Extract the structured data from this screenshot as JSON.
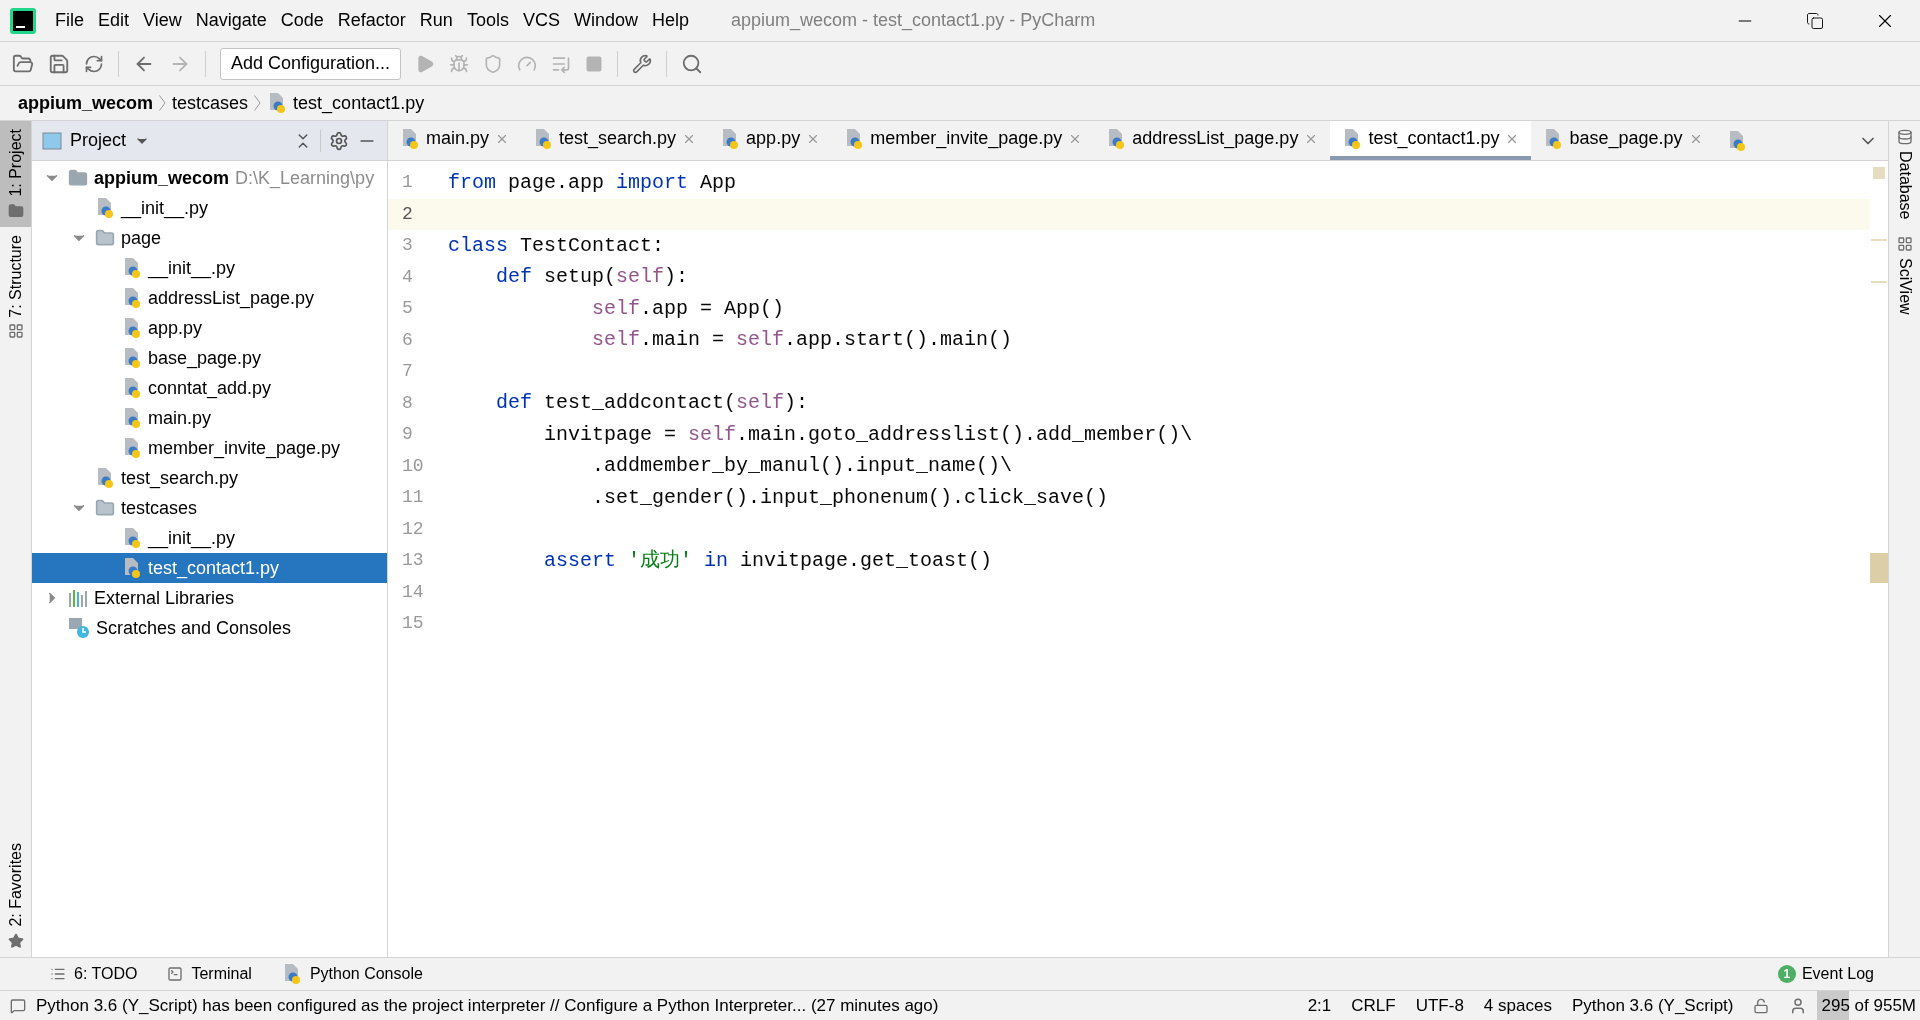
{
  "window": {
    "title": "appium_wecom - test_contact1.py - PyCharm"
  },
  "menu": [
    "File",
    "Edit",
    "View",
    "Navigate",
    "Code",
    "Refactor",
    "Run",
    "Tools",
    "VCS",
    "Window",
    "Help"
  ],
  "toolbar": {
    "run_configuration": "Add Configuration..."
  },
  "breadcrumb": [
    {
      "label": "appium_wecom",
      "kind": "project"
    },
    {
      "label": "testcases",
      "kind": "folder"
    },
    {
      "label": "test_contact1.py",
      "kind": "file"
    }
  ],
  "left_stripe": [
    {
      "label": "1: Project",
      "selected": true,
      "kind": "project"
    },
    {
      "label": "7: Structure",
      "selected": false,
      "kind": "structure"
    },
    {
      "label": "2: Favorites",
      "selected": false,
      "kind": "favorites"
    }
  ],
  "project_panel": {
    "title": "Project",
    "tree": [
      {
        "label": "appium_wecom",
        "hint": "D:\\K_Learning\\py",
        "kind": "root",
        "expanded": true,
        "selected": false,
        "children": [
          {
            "label": "__init__.py",
            "kind": "file",
            "selected": false
          },
          {
            "label": "page",
            "kind": "folder",
            "expanded": true,
            "selected": false,
            "children": [
              {
                "label": "__init__.py",
                "kind": "file",
                "selected": false
              },
              {
                "label": "addressList_page.py",
                "kind": "file",
                "selected": false
              },
              {
                "label": "app.py",
                "kind": "file",
                "selected": false
              },
              {
                "label": "base_page.py",
                "kind": "file",
                "selected": false
              },
              {
                "label": "conntat_add.py",
                "kind": "file",
                "selected": false
              },
              {
                "label": "main.py",
                "kind": "file",
                "selected": false
              },
              {
                "label": "member_invite_page.py",
                "kind": "file",
                "selected": false
              }
            ]
          },
          {
            "label": "test_search.py",
            "kind": "file",
            "selected": false
          },
          {
            "label": "testcases",
            "kind": "folder",
            "expanded": true,
            "selected": false,
            "children": [
              {
                "label": "__init__.py",
                "kind": "file",
                "selected": false
              },
              {
                "label": "test_contact1.py",
                "kind": "file",
                "selected": true
              }
            ]
          }
        ]
      },
      {
        "label": "External Libraries",
        "kind": "libraries",
        "expanded": false,
        "selected": false
      },
      {
        "label": "Scratches and Consoles",
        "kind": "scratches",
        "selected": false
      }
    ]
  },
  "editor": {
    "tabs": [
      {
        "label": "main.py",
        "selected": false
      },
      {
        "label": "test_search.py",
        "selected": false
      },
      {
        "label": "app.py",
        "selected": false
      },
      {
        "label": "member_invite_page.py",
        "selected": false
      },
      {
        "label": "addressList_page.py",
        "selected": false
      },
      {
        "label": "test_contact1.py",
        "selected": true
      },
      {
        "label": "base_page.py",
        "selected": false
      }
    ],
    "lines": [
      {
        "number": "1",
        "current": false,
        "tokens": [
          {
            "text": "from",
            "kind": "kw"
          },
          {
            "text": " page.app ",
            "kind": "plain"
          },
          {
            "text": "import",
            "kind": "kw"
          },
          {
            "text": " App",
            "kind": "plain"
          }
        ]
      },
      {
        "number": "2",
        "current": true
      },
      {
        "number": "3",
        "current": false,
        "tokens": [
          {
            "text": "class",
            "kind": "kw"
          },
          {
            "text": " TestContact:",
            "kind": "plain"
          }
        ]
      },
      {
        "number": "4",
        "current": false,
        "tokens": [
          {
            "text": "    def",
            "kind": "kw"
          },
          {
            "text": " setup(",
            "kind": "plain"
          },
          {
            "text": "self",
            "kind": "self"
          },
          {
            "text": "):",
            "kind": "plain"
          }
        ]
      },
      {
        "number": "5",
        "current": false,
        "tokens": [
          {
            "text": "            self",
            "kind": "self"
          },
          {
            "text": ".app = App()",
            "kind": "plain"
          }
        ]
      },
      {
        "number": "6",
        "current": false,
        "tokens": [
          {
            "text": "            self",
            "kind": "self"
          },
          {
            "text": ".main = ",
            "kind": "plain"
          },
          {
            "text": "self",
            "kind": "self"
          },
          {
            "text": ".app.start().main()",
            "kind": "plain"
          }
        ]
      },
      {
        "number": "7",
        "current": false
      },
      {
        "number": "8",
        "current": false,
        "tokens": [
          {
            "text": "    def",
            "kind": "kw"
          },
          {
            "text": " test_addcontact(",
            "kind": "plain"
          },
          {
            "text": "self",
            "kind": "self"
          },
          {
            "text": "):",
            "kind": "plain"
          }
        ]
      },
      {
        "number": "9",
        "current": false,
        "tokens": [
          {
            "text": "        invitpage = ",
            "kind": "plain"
          },
          {
            "text": "self",
            "kind": "self"
          },
          {
            "text": ".main.goto_addresslist().add_member()\\",
            "kind": "plain"
          }
        ]
      },
      {
        "number": "10",
        "current": false,
        "tokens": [
          {
            "text": "            .addmember_by_manul().input_name()\\",
            "kind": "plain"
          }
        ]
      },
      {
        "number": "11",
        "current": false,
        "tokens": [
          {
            "text": "            .set_gender().input_phonenum().click_save()",
            "kind": "plain"
          }
        ]
      },
      {
        "number": "12",
        "current": false
      },
      {
        "number": "13",
        "current": false,
        "tokens": [
          {
            "text": "        assert",
            "kind": "kw"
          },
          {
            "text": " '成功'",
            "kind": "str"
          },
          {
            "text": " in",
            "kind": "kw"
          },
          {
            "text": " invitpage.get_toast()",
            "kind": "plain"
          }
        ]
      },
      {
        "number": "14",
        "current": false
      },
      {
        "number": "15",
        "current": false
      }
    ]
  },
  "right_stripe": [
    {
      "label": "Database",
      "kind": "database"
    },
    {
      "label": "SciView",
      "kind": "sciview"
    }
  ],
  "tool_tabs": [
    {
      "label": "6: TODO",
      "kind": "todo"
    },
    {
      "label": "Terminal",
      "kind": "terminal"
    },
    {
      "label": "Python Console",
      "kind": "console"
    }
  ],
  "event_log": {
    "label": "Event Log",
    "count": "1"
  },
  "status_bar": {
    "message": "Python 3.6 (Y_Script) has been configured as the project interpreter // Configure a Python Interpreter... (27 minutes ago)",
    "items": [
      "2:1",
      "CRLF",
      "UTF-8",
      "4 spaces",
      "Python 3.6 (Y_Script)"
    ],
    "memory": {
      "label": "295 of 955M",
      "level": 0.31
    }
  }
}
